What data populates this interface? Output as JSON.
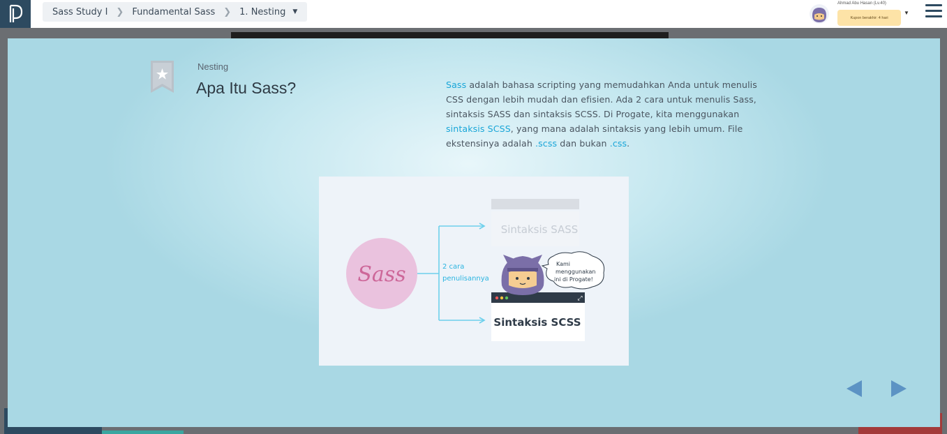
{
  "header": {
    "breadcrumb": [
      "Sass Study I",
      "Fundamental Sass",
      "1. Nesting"
    ],
    "user_name": "Ahmad Abu Hasan (Lv.40)",
    "coupon": "Kupon berakhir: 4 hari"
  },
  "slide": {
    "lesson_tag": "Nesting",
    "title": "Apa Itu Sass?",
    "desc": {
      "p1": "Sass",
      "p2": " adalah bahasa scripting yang memudahkan Anda untuk menulis CSS dengan lebih mudah dan efisien. Ada 2 cara untuk menulis Sass, sintaksis SASS dan sintaksis SCSS. Di Progate, kita menggunakan ",
      "p3": "sintaksis SCSS",
      "p4": ", yang mana adalah sintaksis yang lebih umum. File ekstensinya adalah ",
      "p5": ".scss",
      "p6": " dan bukan ",
      "p7": ".css",
      "p8": "."
    },
    "figure": {
      "logo_text": "Sass",
      "ways_line1": "2 cara",
      "ways_line2": "penulisannya",
      "sass_label": "Sintaksis SASS",
      "scss_label": "Sintaksis SCSS",
      "bubble_line1": "Kami",
      "bubble_line2": "menggunakan",
      "bubble_line3": "ini di Progate!"
    }
  },
  "colors": {
    "highlight": "#1aa6d8",
    "nav_arrow": "#5c93c4",
    "header_dark": "#2d4a60"
  }
}
